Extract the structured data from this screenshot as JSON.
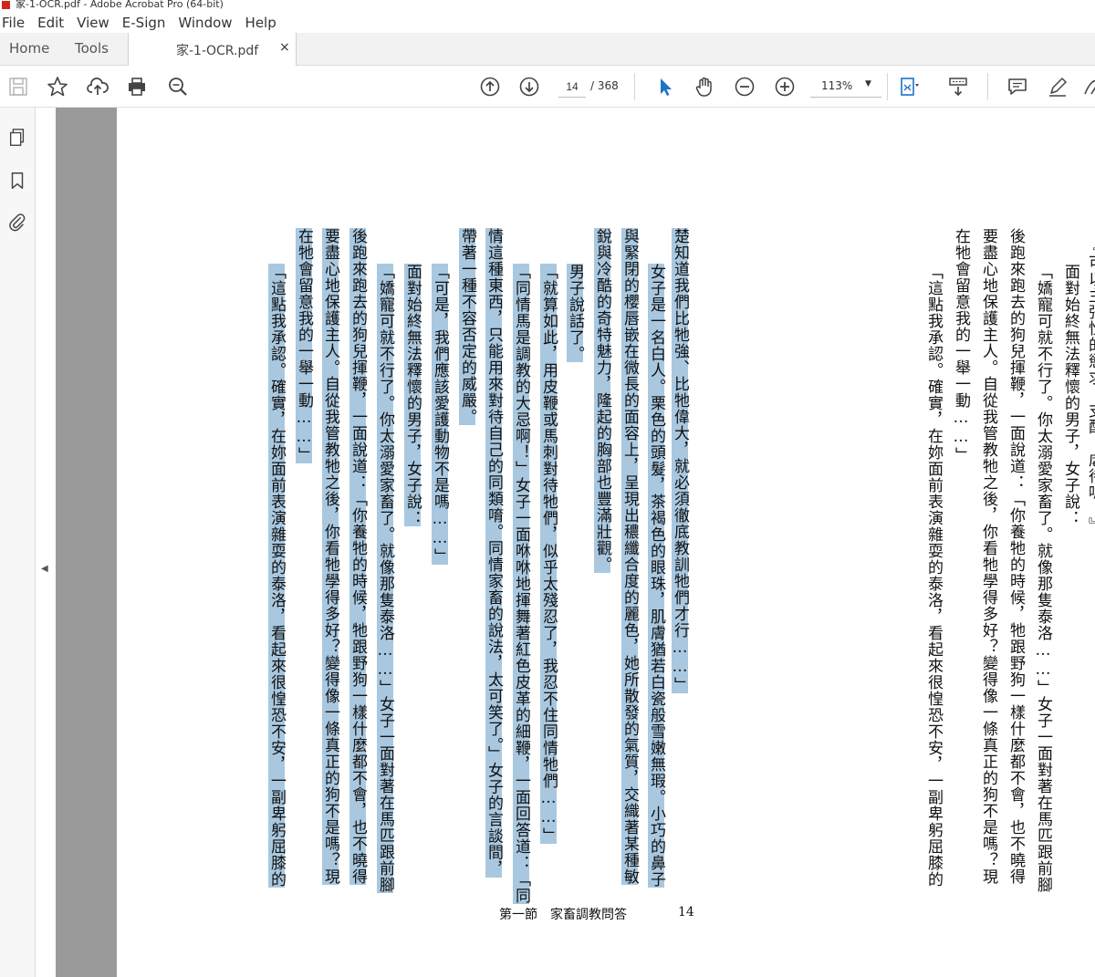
{
  "window": {
    "title": "家-1-OCR.pdf - Adobe Acrobat Pro (64-bit)"
  },
  "menu": [
    "File",
    "Edit",
    "View",
    "E-Sign",
    "Window",
    "Help"
  ],
  "tabs": {
    "home": "Home",
    "tools": "Tools",
    "document": "家-1-OCR.pdf",
    "close": "×"
  },
  "toolbar": {
    "icons": [
      "save-icon",
      "star-icon",
      "upload-icon",
      "print-icon",
      "zoom-search-icon",
      "page-up-icon",
      "page-down-icon",
      "select-cursor-icon",
      "hand-icon",
      "zoom-out-icon",
      "zoom-in-icon",
      "fit-page-icon",
      "scroll-mode-icon",
      "comment-icon",
      "pen-icon",
      "sign-icon"
    ],
    "page_current": "14",
    "page_total": "/ 368",
    "zoom": "113%",
    "zoom_caret": "▼"
  },
  "leftnav": {
    "icons": [
      "page-thumbnails-icon",
      "bookmark-icon",
      "attachment-icon"
    ]
  },
  "collapse_arrow": "◀",
  "document": {
    "columns": [
      {
        "text": "『可以主張性的慾求、支配、虐待嗎？』",
        "highlighted": false
      },
      {
        "text": "面對始終無法釋懷的男子，女子說：",
        "highlighted": false
      },
      {
        "text": "「嬌寵可就不行了。你太溺愛家畜了。就像那隻泰洛……」女子一面對著在馬匹跟前腳",
        "highlighted": false
      },
      {
        "text": "後跑來跑去的狗兒揮鞭，一面說道：「你養牠的時候，牠跟野狗一樣什麼都不會，也不曉得",
        "highlighted": false
      },
      {
        "text": "要盡心地保護主人。自從我管教牠之後，你看牠學得多好？變得像一條真正的狗不是嗎？現",
        "highlighted": false
      },
      {
        "text": "在牠會留意我的一舉一動……」",
        "highlighted": false
      },
      {
        "text": "「這點我承認。確實，在妳面前表演雜耍的泰洛，看起來很惶恐不安，一副卑躬屈膝的",
        "highlighted": false
      },
      {
        "text": "楚知道我們比牠強、比牠偉大，就必須徹底教訓牠們才行……」",
        "highlighted": true
      },
      {
        "text": "女子是一名白人。栗色的頭髮，茶褐色的眼珠，肌膚猶若白瓷般雪嫩無瑕。小巧的鼻子",
        "highlighted": true
      },
      {
        "text": "與緊閉的櫻唇嵌在微長的面容上，呈現出穠纖合度的麗色，她所散發的氣質，交織著某種敏",
        "highlighted": true
      },
      {
        "text": "銳與冷酷的奇特魅力，隆起的胸部也豐滿壯觀。",
        "highlighted": true
      },
      {
        "text": "男子說話了。",
        "highlighted": true
      },
      {
        "text": "「就算如此，用皮鞭或馬刺對待牠們，似乎太殘忍了，我忍不住同情牠們……」",
        "highlighted": true
      },
      {
        "text": "「同情馬是調教的大忌啊！」女子一面咻咻地揮舞著紅色皮革的細鞭，一面回答道：「同",
        "highlighted": true
      },
      {
        "text": "情這種東西，只能用來對待自己的同類唷。同情家畜的說法，太可笑了。」女子的言談間，",
        "highlighted": true
      },
      {
        "text": "帶著一種不容否定的威嚴。",
        "highlighted": true
      },
      {
        "text": "「可是，我們應該愛護動物不是嗎……」",
        "highlighted": true
      },
      {
        "text": "面對始終無法釋懷的男子，女子說：",
        "highlighted": true
      },
      {
        "text": "「嬌寵可就不行了。你太溺愛家畜了。就像那隻泰洛……」女子一面對著在馬匹跟前腳",
        "highlighted": true
      },
      {
        "text": "後跑來跑去的狗兒揮鞭，一面說道：「你養牠的時候，牠跟野狗一樣什麼都不會，也不曉得",
        "highlighted": true
      },
      {
        "text": "要盡心地保護主人。自從我管教牠之後，你看牠學得多好？變得像一條真正的狗不是嗎？現",
        "highlighted": true
      },
      {
        "text": "在牠會留意我的一舉一動……」",
        "highlighted": true
      },
      {
        "text": "「這點我承認。確實，在妳面前表演雜耍的泰洛，看起來很惶恐不安，一副卑躬屈膝的",
        "highlighted": true
      }
    ],
    "footer_title": "第一節　家畜調教問答",
    "footer_page": "14"
  }
}
